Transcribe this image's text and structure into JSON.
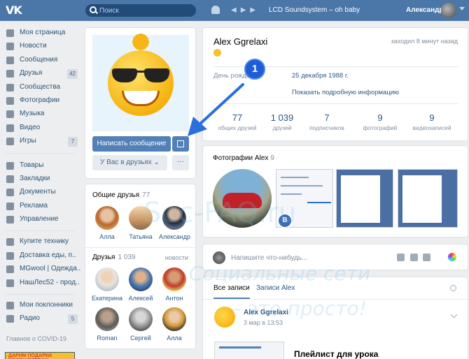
{
  "header": {
    "logo": "VK",
    "search_placeholder": "Поиск",
    "track": "LCD Soundsystem – oh baby",
    "user_name": "Александр"
  },
  "sidebar": {
    "items": [
      {
        "label": "Моя страница",
        "icon": "home-icon",
        "count": ""
      },
      {
        "label": "Новости",
        "icon": "news-icon",
        "count": ""
      },
      {
        "label": "Сообщения",
        "icon": "messages-icon",
        "count": ""
      },
      {
        "label": "Друзья",
        "icon": "friends-icon",
        "count": "42"
      },
      {
        "label": "Сообщества",
        "icon": "groups-icon",
        "count": ""
      },
      {
        "label": "Фотографии",
        "icon": "photos-icon",
        "count": ""
      },
      {
        "label": "Музыка",
        "icon": "music-icon",
        "count": ""
      },
      {
        "label": "Видео",
        "icon": "video-icon",
        "count": ""
      },
      {
        "label": "Игры",
        "icon": "games-icon",
        "count": "7"
      }
    ],
    "items2": [
      {
        "label": "Товары",
        "icon": "goods-icon"
      },
      {
        "label": "Закладки",
        "icon": "bookmarks-icon"
      },
      {
        "label": "Документы",
        "icon": "documents-icon"
      },
      {
        "label": "Реклама",
        "icon": "ads-icon"
      },
      {
        "label": "Управление",
        "icon": "manage-icon"
      }
    ],
    "items3": [
      {
        "label": "Купите технику",
        "icon": "group-icon"
      },
      {
        "label": "Доставка еды, п..",
        "icon": "group-icon"
      },
      {
        "label": "MGwool | Одежда..",
        "icon": "group-icon"
      },
      {
        "label": "НашЛес52 - прод..",
        "icon": "group-icon"
      }
    ],
    "items4": [
      {
        "label": "Мои поклонники",
        "icon": "apps-icon",
        "count": ""
      },
      {
        "label": "Радио",
        "icon": "apps-icon",
        "count": "5"
      }
    ],
    "covid": "Главное о COVID-19",
    "promo": "ДАРИМ ПОДАРКИ СООБЩЕСТВАМ"
  },
  "profile": {
    "write_message": "Написать сообщение",
    "in_friends": "У Вас в друзьях",
    "more": "···",
    "name": "Alex Ggrelaxi",
    "online": "заходил 8 минут назад",
    "birthday_label": "День рождения:",
    "birthday_value": "25 декабря 1988 г.",
    "more_info": "Показать подробную информацию",
    "stats": [
      {
        "value": "77",
        "label": "общих друзей"
      },
      {
        "value": "1 039",
        "label": "друзей"
      },
      {
        "value": "7",
        "label": "подписчиков"
      },
      {
        "value": "9",
        "label": "фотографий"
      },
      {
        "value": "9",
        "label": "видеозаписей"
      }
    ]
  },
  "callout": {
    "number": "1"
  },
  "common_friends": {
    "title": "Общие друзья",
    "count": "77",
    "people": [
      "Алла",
      "Татьяна",
      "Александр"
    ]
  },
  "friends": {
    "title": "Друзья",
    "count": "1 039",
    "updates": "новости",
    "people": [
      "Екатерина",
      "Алексей",
      "Антон",
      "Roman",
      "Сергей",
      "Алла"
    ]
  },
  "photos": {
    "title": "Фотографии Alex",
    "count": "9",
    "badge": "B"
  },
  "composer": {
    "placeholder": "Напишите что-нибудь..."
  },
  "wall": {
    "tab_all": "Все записи",
    "tab_own": "Записи Alex",
    "post_author": "Alex Ggrelaxi",
    "post_date": "3 мар в 13:53",
    "post_title": "Плейлист для урока"
  },
  "watermark": {
    "line1": "Soc-FAQ.ru",
    "line2": "Социальные сети",
    "line3": "– это просто!"
  }
}
